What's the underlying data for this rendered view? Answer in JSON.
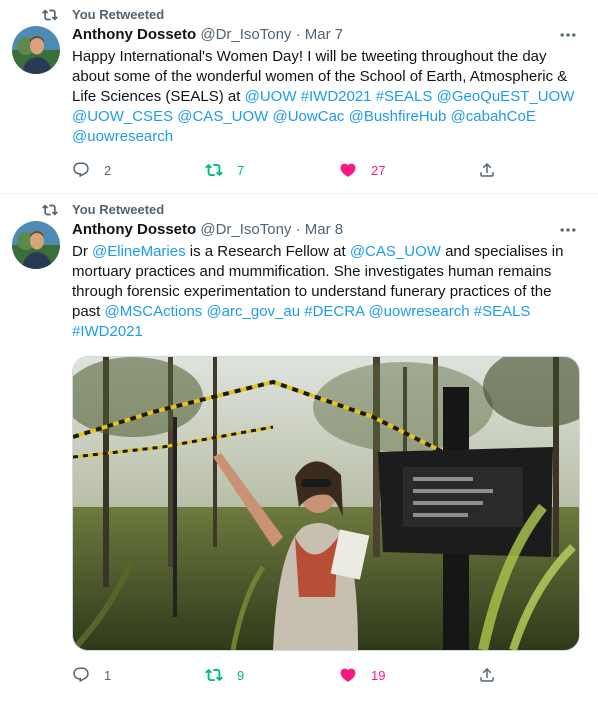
{
  "tweets": [
    {
      "retweet_label": "You Retweeted",
      "name": "Anthony Dosseto",
      "handle": "@Dr_IsoTony",
      "separator": "·",
      "date": "Mar 7",
      "text_parts": [
        {
          "t": "Happy International's Women Day! I will be tweeting throughout the day about some of the wonderful women of the School of Earth, Atmospheric & Life Sciences (SEALS) at ",
          "link": false
        },
        {
          "t": "@UOW",
          "link": true
        },
        {
          "t": " ",
          "link": false
        },
        {
          "t": "#IWD2021",
          "link": true
        },
        {
          "t": " ",
          "link": false
        },
        {
          "t": "#SEALS",
          "link": true
        },
        {
          "t": " ",
          "link": false
        },
        {
          "t": "@GeoQuEST_UOW",
          "link": true
        },
        {
          "t": " ",
          "link": false
        },
        {
          "t": "@UOW_CSES",
          "link": true
        },
        {
          "t": " ",
          "link": false
        },
        {
          "t": "@CAS_UOW",
          "link": true
        },
        {
          "t": " ",
          "link": false
        },
        {
          "t": "@UowCac",
          "link": true
        },
        {
          "t": " ",
          "link": false
        },
        {
          "t": "@BushfireHub",
          "link": true
        },
        {
          "t": " ",
          "link": false
        },
        {
          "t": "@cabahCoE",
          "link": true
        },
        {
          "t": " ",
          "link": false
        },
        {
          "t": "@uowresearch",
          "link": true
        }
      ],
      "replies": "2",
      "retweets": "7",
      "likes": "27"
    },
    {
      "retweet_label": "You Retweeted",
      "name": "Anthony Dosseto",
      "handle": "@Dr_IsoTony",
      "separator": "·",
      "date": "Mar 8",
      "text_parts": [
        {
          "t": "Dr ",
          "link": false
        },
        {
          "t": "@ElineMaries",
          "link": true
        },
        {
          "t": " is a Research Fellow at ",
          "link": false
        },
        {
          "t": "@CAS_UOW",
          "link": true
        },
        {
          "t": " and specialises in mortuary practices and mummification. She investigates human remains through forensic experimentation to understand funerary practices of the past ",
          "link": false
        },
        {
          "t": "@MSCActions",
          "link": true
        },
        {
          "t": " ",
          "link": false
        },
        {
          "t": "@arc_gov_au",
          "link": true
        },
        {
          "t": " ",
          "link": false
        },
        {
          "t": "#DECRA",
          "link": true
        },
        {
          "t": " ",
          "link": false
        },
        {
          "t": "@uowresearch",
          "link": true
        },
        {
          "t": " ",
          "link": false
        },
        {
          "t": "#SEALS",
          "link": true
        },
        {
          "t": " ",
          "link": false
        },
        {
          "t": "#IWD2021",
          "link": true
        }
      ],
      "replies": "1",
      "retweets": "9",
      "likes": "19"
    }
  ],
  "colors": {
    "link": "#1d9bf0",
    "muted": "#536471",
    "retweet_green": "#00ba7c",
    "like_pink": "#f91880",
    "divider": "#eff3f4"
  },
  "icons": {
    "retweet_indicator": "retweet-icon",
    "more": "more-dots-icon",
    "reply": "reply-icon",
    "retweet": "retweet-icon",
    "like": "heart-filled-icon",
    "share": "share-icon"
  }
}
